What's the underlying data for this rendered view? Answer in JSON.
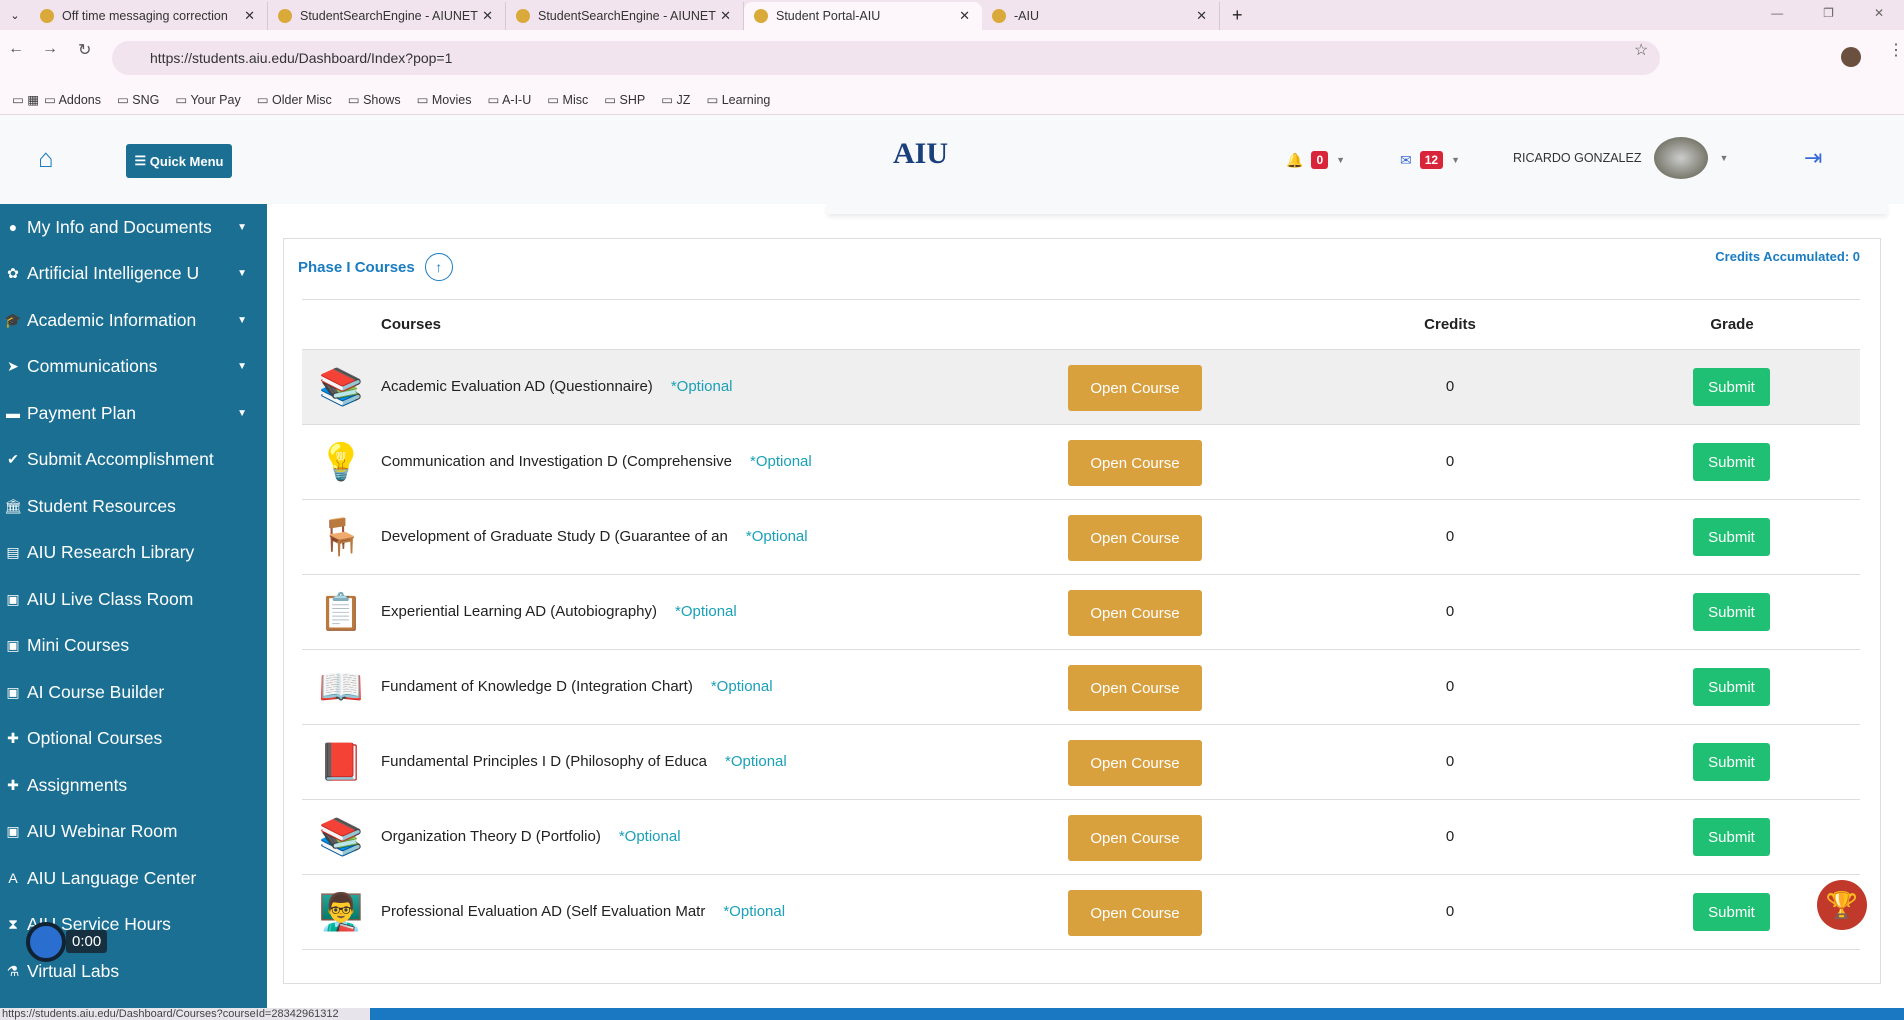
{
  "browser": {
    "tabs": [
      {
        "title": "Off time messaging correction"
      },
      {
        "title": "StudentSearchEngine - AIUNET"
      },
      {
        "title": "StudentSearchEngine - AIUNET"
      },
      {
        "title": "Student Portal-AIU",
        "active": true
      },
      {
        "title": "-AIU"
      }
    ],
    "url": "https://students.aiu.edu/Dashboard/Index?pop=1",
    "bookmarks": [
      "Addons",
      "SNG",
      "Your Pay",
      "Older Misc",
      "Shows",
      "Movies",
      "A-I-U",
      "Misc",
      "SHP",
      "JZ",
      "Learning"
    ],
    "status_url": "https://students.aiu.edu/Dashboard/Courses?courseId=28342961312"
  },
  "header": {
    "quick_menu": "Quick Menu",
    "logo": "AIU",
    "notifications": "0",
    "messages": "12",
    "user": "RICARDO GONZALEZ"
  },
  "sidebar": [
    {
      "label": "My Info and Documents",
      "icon": "user-circle",
      "caret": true
    },
    {
      "label": "Artificial Intelligence U",
      "icon": "brain",
      "caret": true
    },
    {
      "label": "Academic Information",
      "icon": "graduation-cap",
      "caret": true
    },
    {
      "label": "Communications",
      "icon": "paper-plane",
      "caret": true
    },
    {
      "label": "Payment Plan",
      "icon": "credit-card",
      "caret": true
    },
    {
      "label": "Submit Accomplishment",
      "icon": "check-circle"
    },
    {
      "label": "Student Resources",
      "icon": "bank"
    },
    {
      "label": "AIU Research Library",
      "icon": "book"
    },
    {
      "label": "AIU Live Class Room",
      "icon": "chalkboard"
    },
    {
      "label": "Mini Courses",
      "icon": "chalkboard"
    },
    {
      "label": "AI Course Builder",
      "icon": "chalkboard"
    },
    {
      "label": "Optional Courses",
      "icon": "puzzle"
    },
    {
      "label": "Assignments",
      "icon": "puzzle"
    },
    {
      "label": "AIU Webinar Room",
      "icon": "chalkboard"
    },
    {
      "label": "AIU Language Center",
      "icon": "language"
    },
    {
      "label": "AIU Service Hours",
      "icon": "hourglass"
    },
    {
      "label": "Virtual Labs",
      "icon": "flask"
    }
  ],
  "recorder": {
    "time": "0:00"
  },
  "panel": {
    "title": "Phase I Courses",
    "credits": "Credits Accumulated: 0",
    "headers": {
      "courses": "Courses",
      "credits": "Credits",
      "grade": "Grade"
    },
    "courses": [
      {
        "name": "Academic Evaluation AD (Questionnaire)",
        "tag": "*Optional",
        "open": "Open Course",
        "credits": "0",
        "grade": "Submit",
        "icon": "📚"
      },
      {
        "name": "Communication and Investigation D (Comprehensive",
        "tag": "*Optional",
        "open": "Open Course",
        "credits": "0",
        "grade": "Submit",
        "icon": "💡"
      },
      {
        "name": "Development of Graduate Study D (Guarantee of an",
        "tag": "*Optional",
        "open": "Open Course",
        "credits": "0",
        "grade": "Submit",
        "icon": "🪑"
      },
      {
        "name": "Experiential Learning AD (Autobiography)",
        "tag": "*Optional",
        "open": "Open Course",
        "credits": "0",
        "grade": "Submit",
        "icon": "📋"
      },
      {
        "name": "Fundament of Knowledge D (Integration Chart)",
        "tag": "*Optional",
        "open": "Open Course",
        "credits": "0",
        "grade": "Submit",
        "icon": "📖"
      },
      {
        "name": "Fundamental Principles I D (Philosophy of Educa",
        "tag": "*Optional",
        "open": "Open Course",
        "credits": "0",
        "grade": "Submit",
        "icon": "📕"
      },
      {
        "name": "Organization Theory D (Portfolio)",
        "tag": "*Optional",
        "open": "Open Course",
        "credits": "0",
        "grade": "Submit",
        "icon": "📚"
      },
      {
        "name": "Professional Evaluation AD (Self Evaluation Matr",
        "tag": "*Optional",
        "open": "Open Course",
        "credits": "0",
        "grade": "Submit",
        "icon": "👨‍🏫"
      }
    ]
  }
}
